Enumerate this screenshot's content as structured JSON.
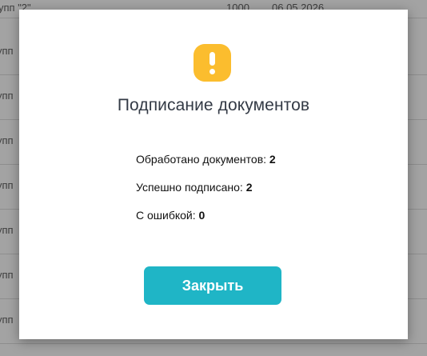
{
  "background_table": {
    "first_row": {
      "name": "упп \"2\"",
      "amount": "1000",
      "date": "06.05.2026"
    },
    "row_prefix": "упп"
  },
  "modal": {
    "title": "Подписание документов",
    "stats": [
      {
        "label": "Обработано документов:",
        "value": "2"
      },
      {
        "label": "Успешно подписано:",
        "value": "2"
      },
      {
        "label": "С ошибкой:",
        "value": "0"
      }
    ],
    "close_button_label": "Закрыть",
    "colors": {
      "icon": "#fbbd2e",
      "button": "#1fb5c6"
    },
    "icon": "warning-icon"
  }
}
